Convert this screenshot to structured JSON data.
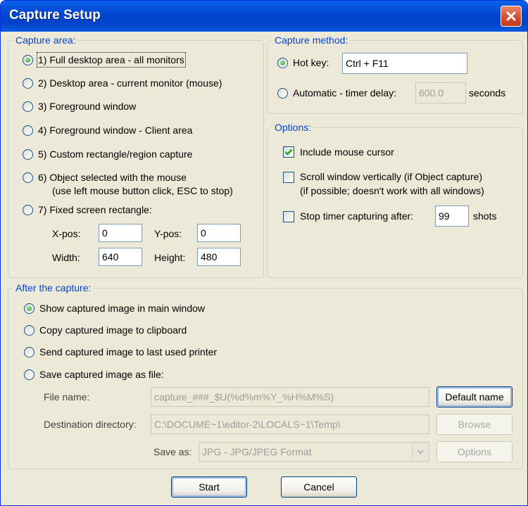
{
  "window": {
    "title": "Capture Setup"
  },
  "capture_area": {
    "legend": "Capture area:",
    "options": [
      "1) Full desktop area - all monitors",
      "2) Desktop area - current monitor (mouse)",
      "3) Foreground window",
      "4) Foreground window - Client area",
      "5) Custom rectangle/region capture",
      "6) Object selected with the mouse",
      "7) Fixed screen rectangle:"
    ],
    "option6_note": "(use left mouse button click, ESC to stop)",
    "selected_index": 0,
    "xpos_label": "X-pos:",
    "xpos_value": "0",
    "ypos_label": "Y-pos:",
    "ypos_value": "0",
    "width_label": "Width:",
    "width_value": "640",
    "height_label": "Height:",
    "height_value": "480"
  },
  "capture_method": {
    "legend": "Capture method:",
    "hotkey_label": "Hot key:",
    "hotkey_value": "Ctrl + F11",
    "automatic_label": "Automatic - timer delay:",
    "timer_value": "600.0",
    "seconds_label": "seconds",
    "selected": "hotkey"
  },
  "options": {
    "legend": "Options:",
    "include_cursor": "Include mouse cursor",
    "include_cursor_checked": true,
    "scroll_window": "Scroll window vertically (if Object capture)",
    "scroll_note": "(if possible; doesn't work with all windows)",
    "scroll_checked": false,
    "stop_timer": "Stop timer capturing after:",
    "stop_timer_value": "99",
    "shots_label": "shots",
    "stop_timer_checked": false
  },
  "after": {
    "legend": "After the capture:",
    "options": [
      "Show captured image in main window",
      "Copy captured image to clipboard",
      "Send captured image to last used printer",
      "Save captured image as file:"
    ],
    "selected_index": 0,
    "file_name_label": "File name:",
    "file_name_value": "capture_###_$U(%d%m%Y_%H%M%S)",
    "default_name_button": "Default name",
    "dest_dir_label": "Destination directory:",
    "dest_dir_value": "C:\\DOCUME~1\\editor-2\\LOCALS~1\\Temp\\",
    "browse_button": "Browse",
    "save_as_label": "Save as:",
    "save_as_value": "JPG - JPG/JPEG Format",
    "options_button": "Options"
  },
  "footer": {
    "start_button": "Start",
    "cancel_button": "Cancel"
  },
  "colors": {
    "titlebar": "#0447d4",
    "legend": "#0046d5",
    "dialog_bg": "#ece9d8",
    "check_mark": "#21a121",
    "close_button": "#d34b2e"
  }
}
